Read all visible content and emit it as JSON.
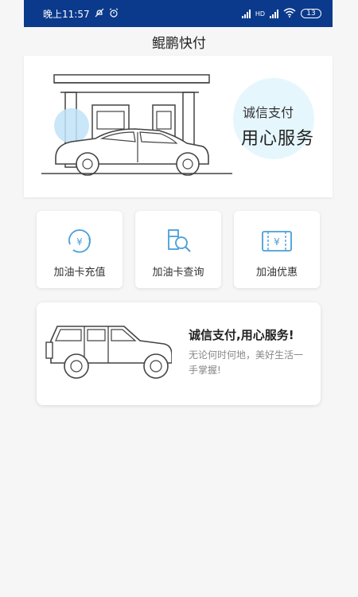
{
  "status_bar": {
    "time": "晚上11:57",
    "network_label": "HD",
    "battery": "13"
  },
  "header": {
    "title": "鲲鹏快付"
  },
  "banner": {
    "line1": "诚信支付",
    "line2": "用心服务"
  },
  "tiles": [
    {
      "label": "加油卡充值",
      "icon": "yuan-circle-icon"
    },
    {
      "label": "加油卡查询",
      "icon": "pump-search-icon"
    },
    {
      "label": "加油优惠",
      "icon": "coupon-icon"
    }
  ],
  "promo": {
    "title": "诚信支付,用心服务!",
    "description": "无论何时何地，美好生活一手掌握!"
  },
  "colors": {
    "status_bar": "#0b3a8c",
    "accent_blue": "#4a9ed8",
    "light_blue": "#e6f6fd"
  }
}
